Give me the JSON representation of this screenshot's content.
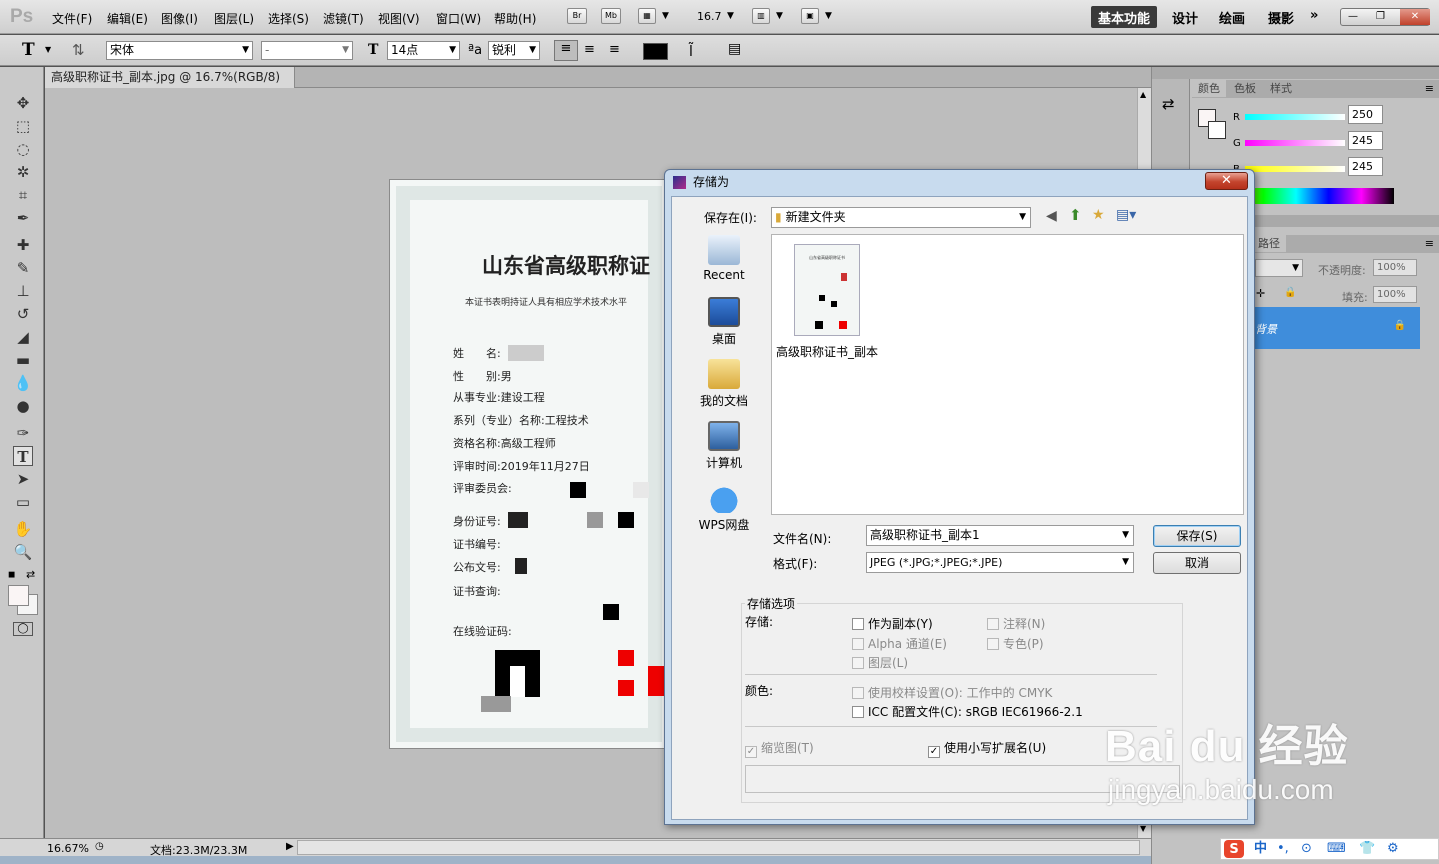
{
  "app": {
    "logo": "Ps"
  },
  "menu": {
    "items": [
      "文件(F)",
      "编辑(E)",
      "图像(I)",
      "图层(L)",
      "选择(S)",
      "滤镜(T)",
      "视图(V)",
      "窗口(W)",
      "帮助(H)"
    ]
  },
  "toolbar_icons": {
    "br": "Br",
    "mb": "Mb",
    "zoom": "16.7"
  },
  "workspaces": {
    "active": "基本功能",
    "items": [
      "设计",
      "绘画",
      "摄影"
    ],
    "more": "»"
  },
  "window_buttons": {
    "min": "—",
    "restore": "❐",
    "close": "✕"
  },
  "options_bar": {
    "tool_glyph": "T",
    "font_family": "宋体",
    "font_style": "-",
    "font_size": "14点",
    "aa_label": "ªa",
    "anti_alias": "锐利",
    "color": "#000000"
  },
  "document": {
    "tab_title": "高级职称证书_副本.jpg @ 16.7%(RGB/8)",
    "tab_close": "⊠"
  },
  "certificate": {
    "title": "山东省高级职称证",
    "subtitle": "本证书表明持证人具有相应学术技术水平",
    "lines": [
      {
        "label": "姓　　名:",
        "value": ""
      },
      {
        "label": "性　　别:",
        "value": "男"
      },
      {
        "label": "从事专业:",
        "value": "建设工程"
      },
      {
        "label": "系列（专业）名称:",
        "value": "工程技术"
      },
      {
        "label": "资格名称:",
        "value": "高级工程师"
      },
      {
        "label": "评审时间:",
        "value": "2019年11月27日"
      },
      {
        "label": "评审委员会:",
        "value": ""
      },
      {
        "label": "身份证号:",
        "value": ""
      },
      {
        "label": "证书编号:",
        "value": ""
      },
      {
        "label": "公布文号:",
        "value": ""
      },
      {
        "label": "证书查询:",
        "value": ""
      },
      {
        "label": "在线验证码:",
        "value": ""
      }
    ]
  },
  "status": {
    "zoom": "16.67%",
    "doc_info": "文档:23.3M/23.3M"
  },
  "right_panel": {
    "color_tabs": [
      "颜色",
      "色板",
      "样式"
    ],
    "channels": [
      {
        "label": "R",
        "value": "250"
      },
      {
        "label": "G",
        "value": "245"
      },
      {
        "label": "B",
        "value": "245"
      }
    ],
    "layers_tab": "路径",
    "opacity_label": "不透明度:",
    "opacity_value": "100%",
    "fill_label": "填充:",
    "fill_value": "100%",
    "layer_name": "背景"
  },
  "dialog": {
    "title": "存储为",
    "close": "✕",
    "save_in_label": "保存在(I):",
    "save_in_value": "新建文件夹",
    "places": [
      "Recent",
      "桌面",
      "我的文档",
      "计算机",
      "WPS网盘"
    ],
    "files": [
      {
        "name": "高级职称证书_副本"
      }
    ],
    "thumb_title": "山东省高级职称证书",
    "filename_label": "文件名(N):",
    "filename_value": "高级职称证书_副本1",
    "format_label": "格式(F):",
    "format_value": "JPEG (*.JPG;*.JPEG;*.JPE)",
    "save_button": "保存(S)",
    "cancel_button": "取消",
    "options_title": "存储选项",
    "save_label": "存储:",
    "opt_as_copy": "作为副本(Y)",
    "opt_notes": "注释(N)",
    "opt_alpha": "Alpha 通道(E)",
    "opt_spot": "专色(P)",
    "opt_layers": "图层(L)",
    "color_label": "颜色:",
    "opt_proof": "使用校样设置(O):  工作中的 CMYK",
    "opt_icc": "ICC 配置文件(C):  sRGB IEC61966-2.1",
    "opt_thumbnail": "缩览图(T)",
    "opt_lowercase": "使用小写扩展名(U)"
  },
  "watermark": {
    "brand": "Bai du 经验",
    "url": "jingyan.baidu.com"
  },
  "ime": {
    "logo": "S",
    "lang": "中",
    "items": [
      "•,",
      "⊙",
      "⌨",
      "👕",
      "⚙"
    ]
  }
}
